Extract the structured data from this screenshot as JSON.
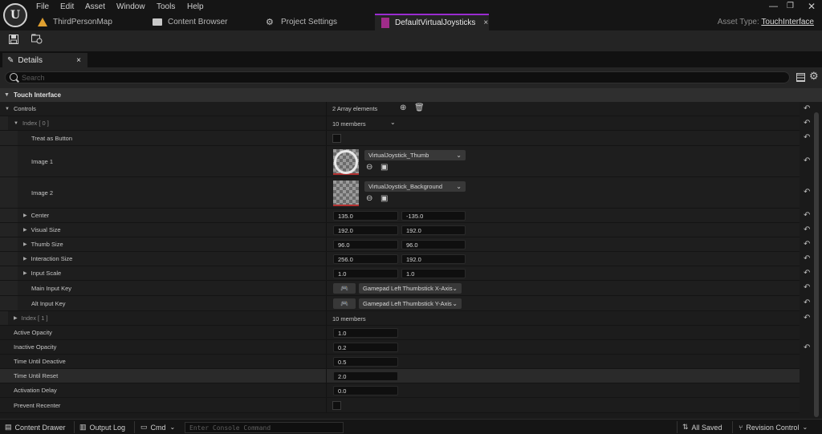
{
  "app": {
    "logo": "U",
    "menu": [
      "File",
      "Edit",
      "Asset",
      "Window",
      "Tools",
      "Help"
    ],
    "tabs": [
      {
        "label": "ThirdPersonMap",
        "icon": "level-icon"
      },
      {
        "label": "Content Browser",
        "icon": "folder-icon"
      },
      {
        "label": "Project Settings",
        "icon": "settings-icon"
      },
      {
        "label": "DefaultVirtualJoysticks",
        "icon": "touch-interface-asset-icon",
        "active": true
      }
    ],
    "tab_close": "×",
    "asset_type_label": "Asset Type:",
    "asset_type_value": "TouchInterface",
    "accent_color": "#9a2bd0"
  },
  "toolbar": {
    "save_icon": "save-icon",
    "browse_icon": "browse-to-asset-icon"
  },
  "details": {
    "tab_label": "Details",
    "tab_close": "×",
    "search_placeholder": "Search",
    "category": "Touch Interface",
    "controls": {
      "label": "Controls",
      "value": "2 Array elements",
      "index0": {
        "label": "Index [ 0 ]",
        "value": "10 members",
        "treat_as_button": "Treat as Button",
        "image1": {
          "label": "Image 1",
          "asset": "VirtualJoystick_Thumb"
        },
        "image2": {
          "label": "Image 2",
          "asset": "VirtualJoystick_Background"
        },
        "center": {
          "label": "Center",
          "x": "135.0",
          "y": "-135.0"
        },
        "visual_size": {
          "label": "Visual Size",
          "x": "192.0",
          "y": "192.0"
        },
        "thumb_size": {
          "label": "Thumb Size",
          "x": "96.0",
          "y": "96.0"
        },
        "interaction_size": {
          "label": "Interaction Size",
          "x": "256.0",
          "y": "192.0"
        },
        "input_scale": {
          "label": "Input Scale",
          "x": "1.0",
          "y": "1.0"
        },
        "main_input_key": {
          "label": "Main Input Key",
          "value": "Gamepad Left Thumbstick X-Axis"
        },
        "alt_input_key": {
          "label": "Alt Input Key",
          "value": "Gamepad Left Thumbstick Y-Axis"
        }
      },
      "index1": {
        "label": "Index [ 1 ]",
        "value": "10 members"
      }
    },
    "active_opacity": {
      "label": "Active Opacity",
      "value": "1.0"
    },
    "inactive_opacity": {
      "label": "Inactive Opacity",
      "value": "0.2"
    },
    "time_until_deactive": {
      "label": "Time Until Deactive",
      "value": "0.5"
    },
    "time_until_reset": {
      "label": "Time Until Reset",
      "value": "2.0"
    },
    "activation_delay": {
      "label": "Activation Delay",
      "value": "0.0"
    },
    "prevent_recenter": {
      "label": "Prevent Recenter"
    }
  },
  "statusbar": {
    "content_drawer": "Content Drawer",
    "output_log": "Output Log",
    "cmd": "Cmd",
    "console_placeholder": "Enter Console Command",
    "all_saved": "All Saved",
    "revision_control": "Revision Control"
  }
}
